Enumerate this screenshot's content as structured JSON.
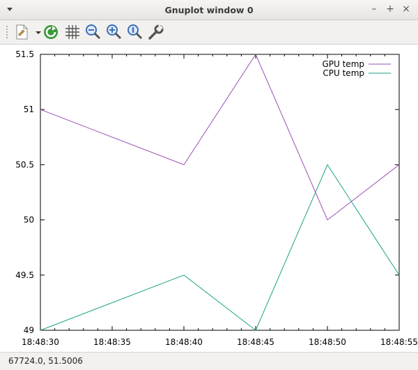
{
  "window": {
    "title": "Gnuplot window 0",
    "controls": {
      "minimize": "–",
      "maximize": "+",
      "close": "×"
    }
  },
  "toolbar": {
    "items": [
      {
        "icon": "copy-export-icon"
      },
      {
        "icon": "dropdown-arrow-icon"
      },
      {
        "icon": "replot-icon"
      },
      {
        "icon": "grid-icon"
      },
      {
        "icon": "zoom-out-icon"
      },
      {
        "icon": "zoom-in-icon"
      },
      {
        "icon": "zoom-previous-icon"
      },
      {
        "icon": "settings-wrench-icon"
      }
    ]
  },
  "status": {
    "text": "67724.0,  51.5006"
  },
  "colors": {
    "gpu": "#9a4fb5",
    "cpu": "#1aa287"
  },
  "chart_data": {
    "type": "line",
    "x": [
      "18:48:30",
      "18:48:40",
      "18:48:45",
      "18:48:50",
      "18:48:55"
    ],
    "x_ticks": [
      "18:48:30",
      "18:48:35",
      "18:48:40",
      "18:48:45",
      "18:48:50",
      "18:48:55"
    ],
    "y_ticks": [
      "49",
      "49.5",
      "50",
      "50.5",
      "51",
      "51.5"
    ],
    "ylim": [
      49,
      51.5
    ],
    "series": [
      {
        "name": "GPU temp",
        "values": [
          51,
          50.5,
          51.5,
          50,
          50.5
        ]
      },
      {
        "name": "CPU temp",
        "values": [
          49,
          49.5,
          49,
          50.5,
          49.5
        ]
      }
    ],
    "legend_position": "top-right",
    "grid": false
  }
}
